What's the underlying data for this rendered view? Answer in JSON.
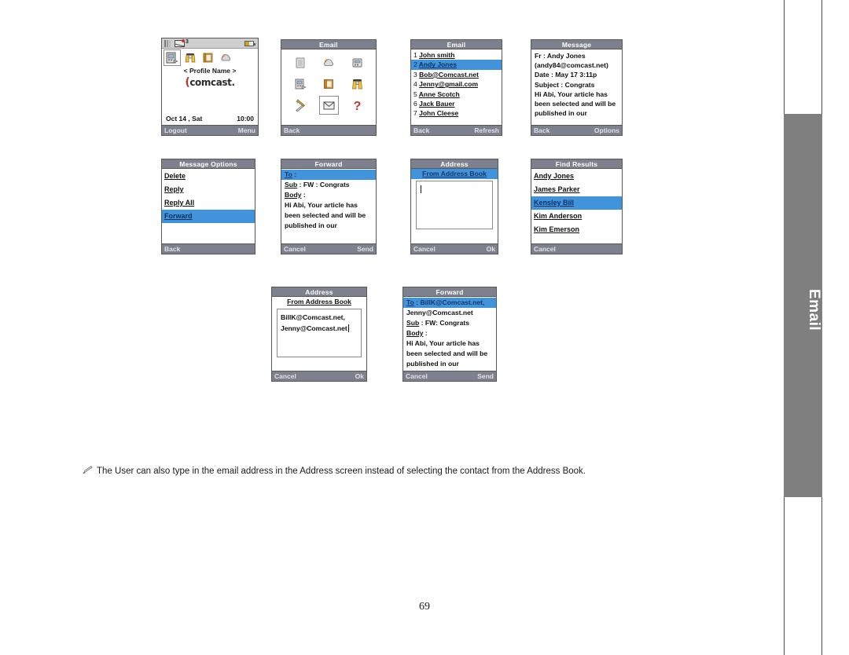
{
  "page": {
    "number": "69",
    "side_tab_label": "Email",
    "note": "The User can also type in the email address in the Address screen instead of selecting the contact from the Address Book.",
    "note_icon": "pencil-icon",
    "highlight_color": "#4194dc",
    "titlebar_color": "#7d818d",
    "tab_color": "#7f7f7f"
  },
  "screens": {
    "idle": {
      "status": {
        "unread_count": "3",
        "signal_icon": "signal-bars-icon",
        "mail_icon": "new-mail-icon",
        "battery_icon": "battery-icon"
      },
      "icons": [
        {
          "name": "device-icon",
          "selected": true
        },
        {
          "name": "binoculars-icon",
          "selected": false
        },
        {
          "name": "book-icon",
          "selected": false
        },
        {
          "name": "weather-cloud-icon",
          "selected": false
        }
      ],
      "profile_name": "< Profile Name >",
      "brand": "comcast",
      "date": "Oct 14 , Sat",
      "time": "10:00",
      "softkey_left": "Logout",
      "softkey_right": "Menu"
    },
    "email_menu": {
      "title": "Email",
      "icons": [
        {
          "name": "notepad-icon",
          "selected": false
        },
        {
          "name": "weather-cloud-icon",
          "selected": false
        },
        {
          "name": "calculator-icon",
          "selected": false
        },
        {
          "name": "phone-icon",
          "selected": false
        },
        {
          "name": "folder-icon",
          "selected": false
        },
        {
          "name": "binoculars-icon",
          "selected": false
        },
        {
          "name": "tools-icon",
          "selected": false
        },
        {
          "name": "envelope-icon",
          "selected": true
        },
        {
          "name": "help-question-icon",
          "selected": false
        }
      ],
      "softkey_left": "Back",
      "softkey_right": ""
    },
    "email_list": {
      "title": "Email",
      "items": [
        {
          "num": "1",
          "label": "John smith",
          "selected": false
        },
        {
          "num": "2",
          "label": "Andy Jones",
          "selected": true
        },
        {
          "num": "3",
          "label": "Bob@Comcast.net",
          "selected": false
        },
        {
          "num": "4",
          "label": "Jenny@gmail.com",
          "selected": false
        },
        {
          "num": "5",
          "label": "Anne Scotch",
          "selected": false
        },
        {
          "num": "6",
          "label": "Jack Bauer",
          "selected": false
        },
        {
          "num": "7",
          "label": "John Cleese",
          "selected": false
        }
      ],
      "softkey_left": "Back",
      "softkey_right": "Refresh"
    },
    "message": {
      "title": "Message",
      "lines": [
        "Fr : Andy Jones",
        "(andy84@comcast.net)",
        "Date : May 17 3:11p",
        "Subject : Congrats",
        "Hi Abi,  Your article has",
        "been selected and will be",
        "published in our"
      ],
      "softkey_left": "Back",
      "softkey_right": "Options"
    },
    "message_options": {
      "title": "Message Options",
      "items": [
        {
          "label": "Delete",
          "selected": false
        },
        {
          "label": "Reply",
          "selected": false
        },
        {
          "label": "Reply All",
          "selected": false
        },
        {
          "label": "Forward",
          "selected": true
        },
        {
          "label": "",
          "selected": false
        }
      ],
      "softkey_left": "Back",
      "softkey_right": ""
    },
    "forward_empty": {
      "title": "Forward",
      "to_label": "To",
      "to_value": " :",
      "sub_label": "Sub",
      "sub_value": " : FW : Congrats",
      "body_label": "Body",
      "body_value": " :",
      "body_lines": [
        "Hi Abi,  Your article has",
        "been selected and will be",
        "published in our"
      ],
      "softkey_left": "Cancel",
      "softkey_right": "Send"
    },
    "address_empty": {
      "title": "Address",
      "header": "From Address Book",
      "value": "",
      "softkey_left": "Cancel",
      "softkey_right": "Ok"
    },
    "find_results": {
      "title": "Find Results",
      "items": [
        {
          "label": "Andy Jones",
          "selected": false
        },
        {
          "label": "James Parker",
          "selected": false
        },
        {
          "label": "Kensley Bill",
          "selected": true
        },
        {
          "label": "Kim Anderson",
          "selected": false
        },
        {
          "label": "Kim Emerson",
          "selected": false
        }
      ],
      "softkey_left": "Cancel",
      "softkey_right": ""
    },
    "address_filled": {
      "title": "Address",
      "header": "From Address Book",
      "line1": "BillK@Comcast.net,",
      "line2": "Jenny@Comcast.net",
      "softkey_left": "Cancel",
      "softkey_right": "Ok"
    },
    "forward_filled": {
      "title": "Forward",
      "to_label": "To",
      "to_value": " : BillK@Comcast.net,",
      "to_overflow": "Jenny@Comcast.net",
      "sub_label": "Sub",
      "sub_value": " : FW: Congrats",
      "body_label": "Body",
      "body_value": " :",
      "body_lines": [
        "Hi Abi,  Your article has",
        "been selected and will be",
        "published in our"
      ],
      "softkey_left": "Cancel",
      "softkey_right": "Send"
    }
  }
}
